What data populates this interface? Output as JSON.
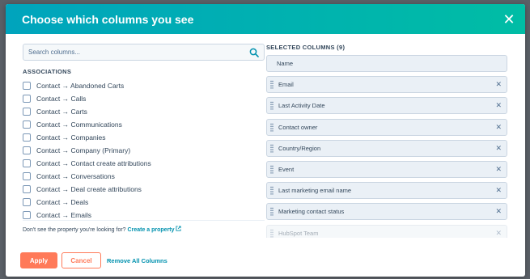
{
  "header": {
    "title": "Choose which columns you see"
  },
  "search": {
    "placeholder": "Search columns..."
  },
  "left": {
    "section_title": "ASSOCIATIONS",
    "items": [
      "Contact → Abandoned Carts",
      "Contact → Calls",
      "Contact → Carts",
      "Contact → Communications",
      "Contact → Companies",
      "Contact → Company (Primary)",
      "Contact → Contact create attributions",
      "Contact → Conversations",
      "Contact → Deal create attributions",
      "Contact → Deals",
      "Contact → Emails"
    ],
    "helper_text": "Don't see the property you're looking for?",
    "helper_link": "Create a property"
  },
  "right": {
    "title": "SELECTED COLUMNS (9)",
    "items": [
      "Name",
      "Email",
      "Last Activity Date",
      "Contact owner",
      "Country/Region",
      "Event",
      "Last marketing email name",
      "Marketing contact status",
      "HubSpot Team"
    ]
  },
  "footer": {
    "apply_label": "Apply",
    "cancel_label": "Cancel",
    "remove_all_label": "Remove All Columns"
  },
  "colors": {
    "header_gradient_start": "#00a4bd",
    "header_gradient_end": "#00bda5",
    "primary_button": "#ff7a59",
    "link": "#0091ae"
  }
}
